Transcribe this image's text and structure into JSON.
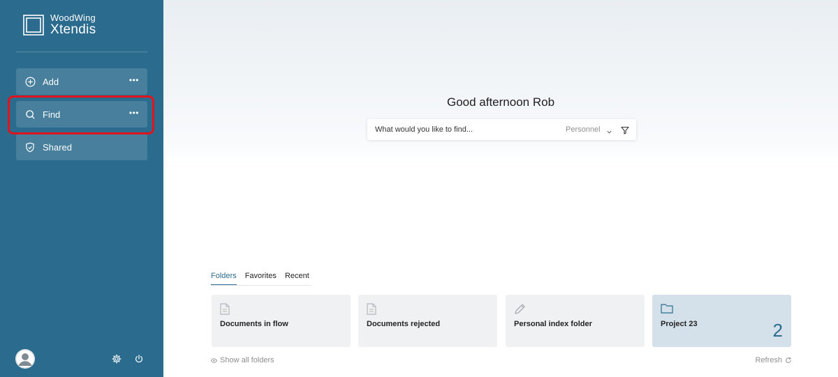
{
  "brand": {
    "line1": "WoodWing",
    "line2": "Xtendis"
  },
  "sidebar": {
    "items": [
      {
        "label": "Add",
        "icon": "plus-circle-icon",
        "more": "•••"
      },
      {
        "label": "Find",
        "icon": "search-icon",
        "more": "•••"
      },
      {
        "label": "Shared",
        "icon": "shield-icon"
      }
    ],
    "footer_icons": [
      "avatar",
      "gear-icon",
      "power-icon"
    ]
  },
  "main": {
    "greeting": "Good afternoon Rob",
    "search": {
      "placeholder": "What would you like to find...",
      "scope": "Personnel"
    },
    "tabs": [
      "Folders",
      "Favorites",
      "Recent"
    ],
    "active_tab": "Folders",
    "cards": [
      {
        "label": "Documents in flow",
        "icon": "document-icon"
      },
      {
        "label": "Documents rejected",
        "icon": "document-icon"
      },
      {
        "label": "Personal index folder",
        "icon": "pencil-icon"
      },
      {
        "label": "Project 23",
        "icon": "folder-icon",
        "count": "2"
      }
    ],
    "show_all": "Show all folders",
    "refresh": "Refresh"
  },
  "colors": {
    "sidebar": "#2b6c8e",
    "nav_item": "#477f9c",
    "highlight": "#e0141d",
    "selected_card": "#d5e1ea"
  }
}
